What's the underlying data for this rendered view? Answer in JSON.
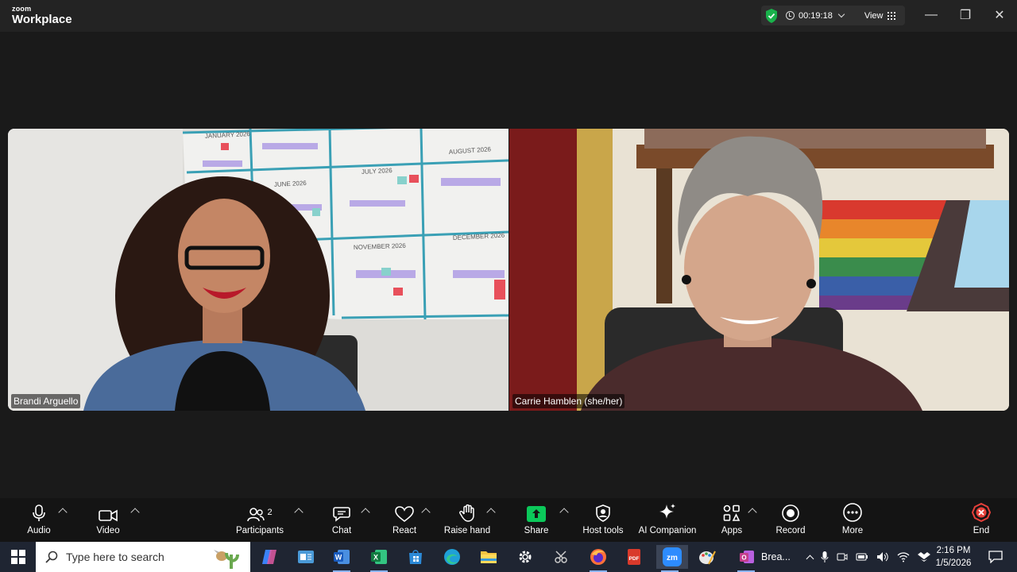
{
  "window": {
    "brand_small": "zoom",
    "brand_large": "Workplace",
    "timer": "00:19:18",
    "view_label": "View",
    "minimize": "—",
    "restore": "❐",
    "close": "✕"
  },
  "participants_video": [
    {
      "name": "Brandi Arguello"
    },
    {
      "name": "Carrie Hamblen (she/her)"
    }
  ],
  "calendar_months": [
    "JANUARY 2026",
    "JULY 2026",
    "AUGUST 2026",
    "JUNE 2026",
    "NOVEMBER 2026",
    "DECEMBER 2026"
  ],
  "toolbar": {
    "audio": "Audio",
    "video": "Video",
    "participants": "Participants",
    "participants_count": "2",
    "chat": "Chat",
    "react": "React",
    "raise_hand": "Raise hand",
    "share": "Share",
    "host_tools": "Host tools",
    "ai_companion": "AI Companion",
    "apps": "Apps",
    "record": "Record",
    "more": "More",
    "end": "End"
  },
  "taskbar": {
    "search_placeholder": "Type here to search",
    "active_window": "Brea...",
    "zoom_app": "zm",
    "pdf_app": "PDF",
    "time": "2:16 PM",
    "date": "1/5/2026"
  },
  "colors": {
    "titlebar": "#232323",
    "background": "#1a1a1a",
    "toolbar": "#141414",
    "taskbar": "#1f2532",
    "share_green": "#0bc85a",
    "end_red": "#e5403a",
    "shield_green": "#19b24b"
  }
}
